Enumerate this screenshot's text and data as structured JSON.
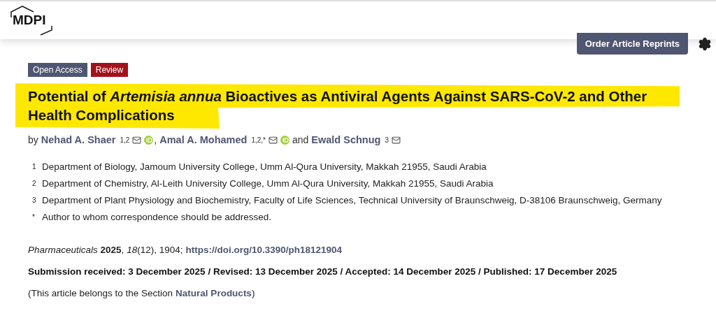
{
  "header": {
    "logo": "MDPI",
    "reprints_button": "Order Article Reprints"
  },
  "badges": [
    {
      "label": "Open Access",
      "kind": "access"
    },
    {
      "label": "Review",
      "kind": "type"
    }
  ],
  "title": "Potential of *Artemisia annua* Bioactives as Antiviral Agents Against SARS-CoV-2 and Other Health Complications",
  "byline": {
    "prefix": "by",
    "and": "and",
    "authors": [
      {
        "name": "Nehad A. Shaer",
        "affiliations": "1,2",
        "email": true,
        "orcid": true,
        "separator": ","
      },
      {
        "name": "Amal A. Mohamed",
        "affiliations": "1,2,*",
        "email": true,
        "orcid": true
      },
      {
        "name": "Ewald Schnug",
        "affiliations": "3",
        "email": true
      }
    ]
  },
  "affiliations": [
    {
      "mark": "1",
      "text": "Department of Biology, Jamoum University College, Umm Al-Qura University, Makkah 21955, Saudi Arabia"
    },
    {
      "mark": "2",
      "text": "Department of Chemistry, Al-Leith University College, Umm Al-Qura University, Makkah 21955, Saudi Arabia"
    },
    {
      "mark": "3",
      "text": "Department of Plant Physiology and Biochemistry, Faculty of Life Sciences, Technical University of Braunschweig, D-38106 Braunschweig, Germany"
    },
    {
      "mark": "*",
      "text": "Author to whom correspondence should be addressed."
    }
  ],
  "citation": {
    "text": "*Pharmaceuticals* **2025**, *18*(12), 1904;",
    "doi": "https://doi.org/10.3390/ph18121904"
  },
  "dates": "Submission received: 3 December 2025 / Revised: 13 December 2025 / Accepted: 14 December 2025 / Published: 17 December 2025",
  "section": {
    "before": "(This article belongs to the Section",
    "link": "Natural Products",
    "after": ")"
  }
}
